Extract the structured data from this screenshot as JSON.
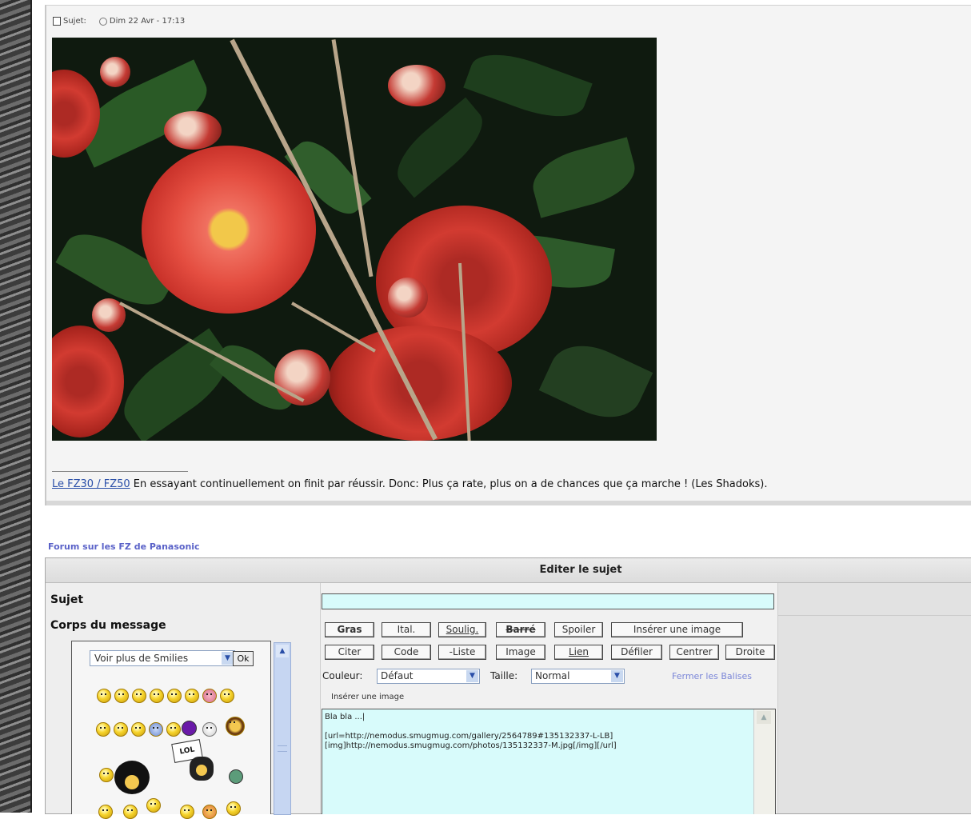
{
  "post": {
    "subject_label": "Sujet:",
    "date": "Dim 22 Avr - 17:13",
    "signature_link": "Le FZ30 / FZ50",
    "signature_text": "En essayant continuellement on finit par réussir. Donc: Plus ça rate, plus on a de chances que ça marche ! (Les Shadoks)."
  },
  "forum_link": "Forum sur les FZ de Panasonic",
  "editor": {
    "title": "Editer le sujet",
    "subject_label": "Sujet",
    "body_label": "Corps du message",
    "subject_value": "",
    "buttons": {
      "gras": "Gras",
      "ital": "Ital.",
      "soulig": "Soulig.",
      "barre": "Barré",
      "spoiler": "Spoiler",
      "inserer_image": "Insérer une image",
      "citer": "Citer",
      "code": "Code",
      "liste": "-Liste",
      "image": "Image",
      "lien": "Lien",
      "defiler": "Défiler",
      "centrer": "Centrer",
      "droite": "Droite"
    },
    "couleur_label": "Couleur:",
    "couleur_value": "Défaut",
    "taille_label": "Taille:",
    "taille_value": "Normal",
    "fermer_balises": "Fermer les Balises",
    "inserer_label": "Insérer une image",
    "message_text": "Bla bla ...|\n\n[url=http://nemodus.smugmug.com/gallery/2564789#135132337-L-LB]\n[img]http://nemodus.smugmug.com/photos/135132337-M.jpg[/img][/url]",
    "smilies_select": "Voir plus de Smilies",
    "ok": "Ok",
    "lol_sign": "LOL"
  }
}
